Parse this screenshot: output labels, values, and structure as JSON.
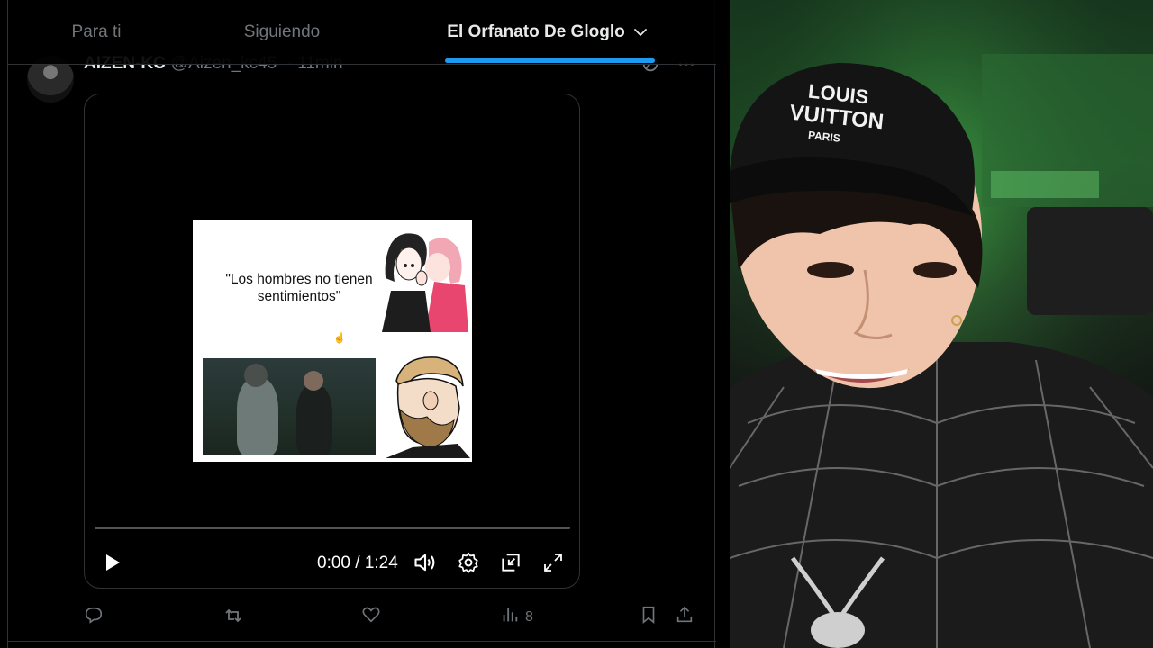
{
  "tabs": [
    {
      "label": "Para ti"
    },
    {
      "label": "Siguiendo"
    },
    {
      "label": "El Orfanato De Gloglo",
      "active": true
    }
  ],
  "tweet": {
    "author_name": "AIZEN-KC",
    "handle": "@Aizen_kc45",
    "time": "· 11min",
    "meme_text": "\"Los hombres no tienen sentimientos\"",
    "views": "8"
  },
  "video": {
    "time_display": "0:00 / 1:24",
    "progress_fraction": 0
  },
  "cam": {
    "cap_text_line1": "LOUIS",
    "cap_text_line2": "VUITTON",
    "cap_text_line3": "PARIS"
  },
  "colors": {
    "accent": "#1d9bf0",
    "muted": "#71767b",
    "text": "#e7e9ea",
    "border": "#2f3336"
  },
  "icons": [
    "chevron-down-icon",
    "grok-icon",
    "more-icon",
    "play-icon",
    "volume-icon",
    "settings-icon",
    "pip-icon",
    "fullscreen-icon",
    "reply-icon",
    "retweet-icon",
    "like-icon",
    "views-icon",
    "bookmark-icon",
    "share-icon"
  ]
}
